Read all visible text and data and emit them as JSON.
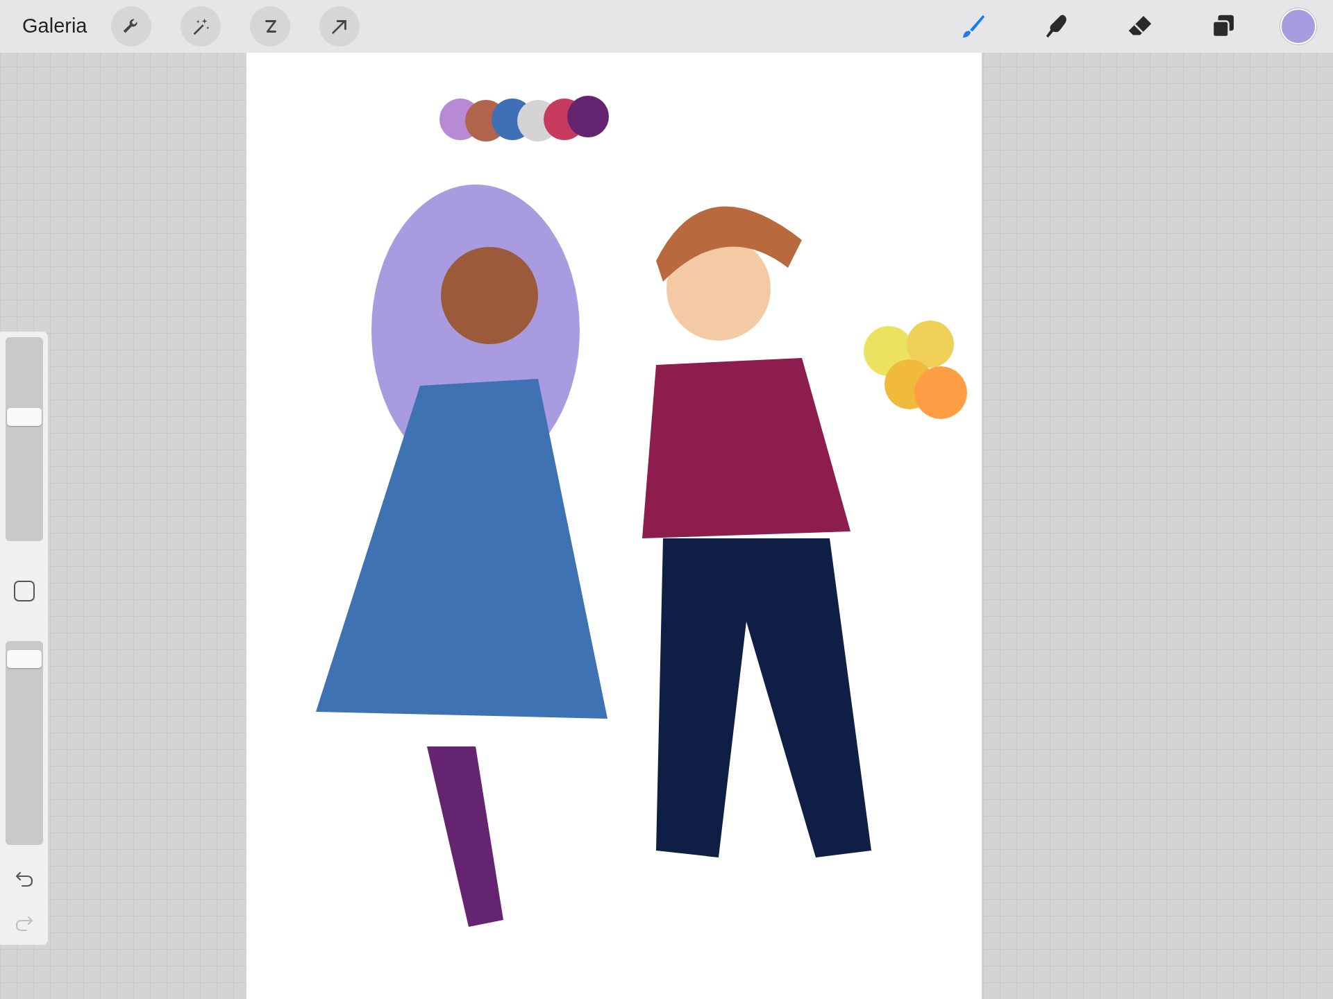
{
  "top_bar": {
    "gallery_label": "Galeria",
    "left_tools": [
      {
        "kind": "wrench",
        "selected": false
      },
      {
        "kind": "wand",
        "selected": false
      },
      {
        "kind": "selection",
        "selected": false
      },
      {
        "kind": "move",
        "selected": false
      }
    ],
    "right_tools": [
      {
        "kind": "brush",
        "selected": true
      },
      {
        "kind": "smudge",
        "selected": false
      },
      {
        "kind": "eraser",
        "selected": false
      },
      {
        "kind": "layers",
        "selected": false
      }
    ],
    "current_color": {
      "color": "#a99be0"
    }
  },
  "sidebar": {
    "size_slider": {
      "level": 0.62
    },
    "opacity_slider": {
      "level": 0.95
    },
    "undo": {
      "disabled": false
    },
    "redo": {
      "disabled": true
    }
  }
}
